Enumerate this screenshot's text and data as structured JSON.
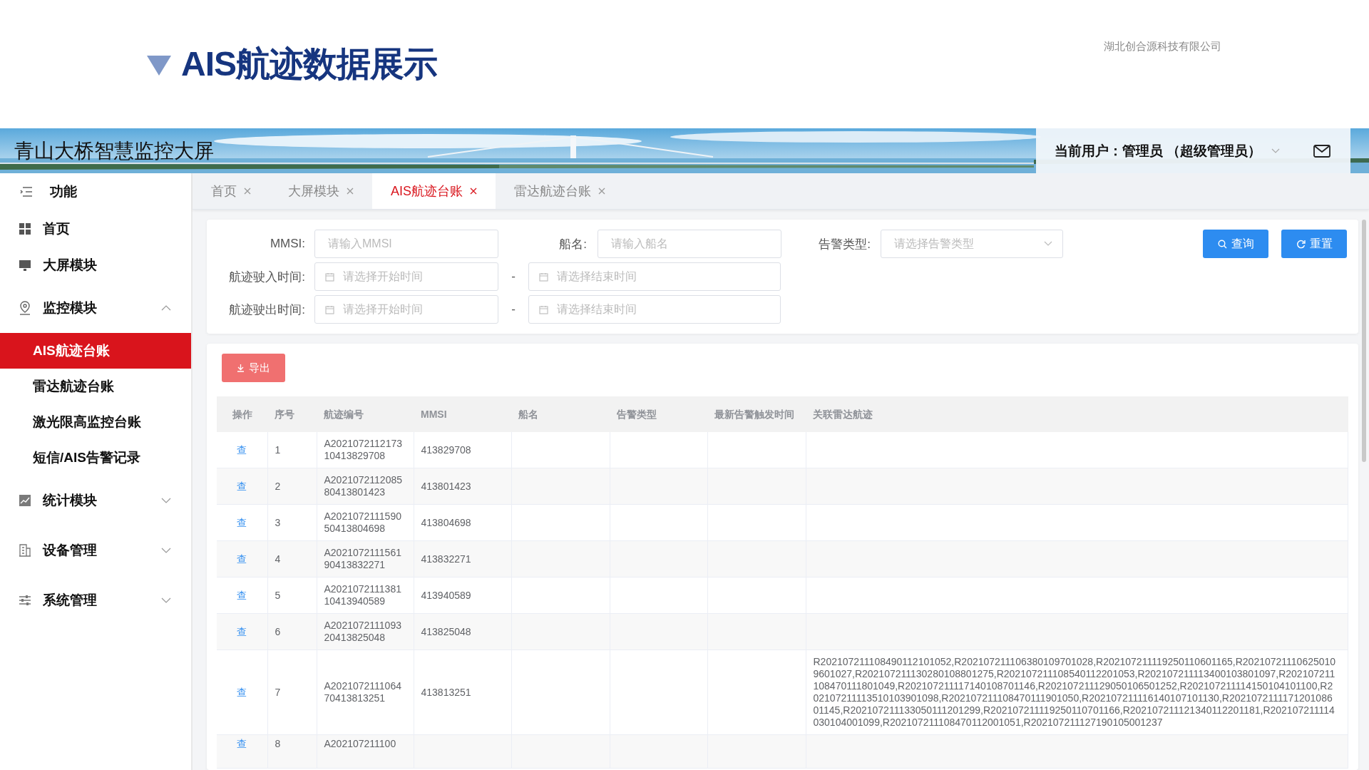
{
  "slide": {
    "title": "AIS航迹数据展示",
    "company": "湖北创合源科技有限公司"
  },
  "banner": {
    "title": "青山大桥智慧监控大屏",
    "user": "当前用户：管理员 （超级管理员）"
  },
  "sidebar": {
    "heading": "功能",
    "items": [
      {
        "label": "首页",
        "kind": "link",
        "selected": false
      },
      {
        "label": "大屏模块",
        "kind": "link",
        "selected": false
      },
      {
        "label": "监控模块",
        "kind": "group",
        "selected": false,
        "expanded": true,
        "children": [
          {
            "label": "AIS航迹台账",
            "selected": true
          },
          {
            "label": "雷达航迹台账",
            "selected": false
          },
          {
            "label": "激光限高监控台账",
            "selected": false
          },
          {
            "label": "短信/AIS告警记录",
            "selected": false
          }
        ]
      },
      {
        "label": "统计模块",
        "kind": "group",
        "selected": false,
        "expanded": false
      },
      {
        "label": "设备管理",
        "kind": "group",
        "selected": false,
        "expanded": false
      },
      {
        "label": "系统管理",
        "kind": "group",
        "selected": false,
        "expanded": false
      }
    ]
  },
  "tabs": [
    {
      "label": "首页",
      "selected": false
    },
    {
      "label": "大屏模块",
      "selected": false
    },
    {
      "label": "AIS航迹台账",
      "selected": true
    },
    {
      "label": "雷达航迹台账",
      "selected": false
    }
  ],
  "filters": {
    "mmsi": {
      "label": "MMSI:",
      "placeholder": "请输入MMSI"
    },
    "ship_name": {
      "label": "船名:",
      "placeholder": "请输入船名"
    },
    "alarm_type": {
      "label": "告警类型:",
      "placeholder": "请选择告警类型"
    },
    "ranges": [
      {
        "label": "航迹驶入时间:",
        "start": {
          "placeholder": "请选择开始时间"
        },
        "separator": "-",
        "end": {
          "placeholder": "请选择结束时间"
        }
      },
      {
        "label": "航迹驶出时间:",
        "start": {
          "placeholder": "请选择开始时间"
        },
        "separator": "-",
        "end": {
          "placeholder": "请选择结束时间"
        }
      }
    ]
  },
  "buttons": [
    {
      "label": "查询",
      "kind": "search"
    },
    {
      "label": "重置",
      "kind": "reset"
    }
  ],
  "export_button": "导出",
  "table": {
    "columns": [
      "操作",
      "序号",
      "航迹编号",
      "MMSI",
      "船名",
      "告警类型",
      "最新告警触发时间",
      "关联雷达航迹"
    ],
    "rows": [
      {
        "action": "查",
        "index": "1",
        "track_id": "A202107211217310413829708",
        "mmsi": "413829708"
      },
      {
        "action": "查",
        "index": "2",
        "track_id": "A202107211208580413801423",
        "mmsi": "413801423"
      },
      {
        "action": "查",
        "index": "3",
        "track_id": "A202107211159050413804698",
        "mmsi": "413804698"
      },
      {
        "action": "查",
        "index": "4",
        "track_id": "A202107211156190413832271",
        "mmsi": "413832271"
      },
      {
        "action": "查",
        "index": "5",
        "track_id": "A202107211138110413940589",
        "mmsi": "413940589"
      },
      {
        "action": "查",
        "index": "6",
        "track_id": "A202107211109320413825048",
        "mmsi": "413825048"
      },
      {
        "action": "查",
        "index": "7",
        "track_id": "A202107211106470413813251",
        "mmsi": "413813251",
        "radar_tracks": "R202107211108490112101052,R202107211106380109701028,R202107211119250110601165,R202107211106250109601027,R202107211130280108801275,R202107211108540112201053,R202107211113400103801097,R202107211108470111801049,R202107211117140108701146,R202107211129050106501252,R202107211114150104101100,R202107211113510103901098,R202107211108470111901050,R202107211116140107101130,R202107211117120108601145,R202107211133050111201299,R202107211119250110701166,R202107211121340112201181,R202107211114030104001099,R202107211108470112001051,R202107211127190105001237"
      },
      {
        "action": "查",
        "index": "8",
        "track_id": "A202107211100"
      }
    ]
  }
}
